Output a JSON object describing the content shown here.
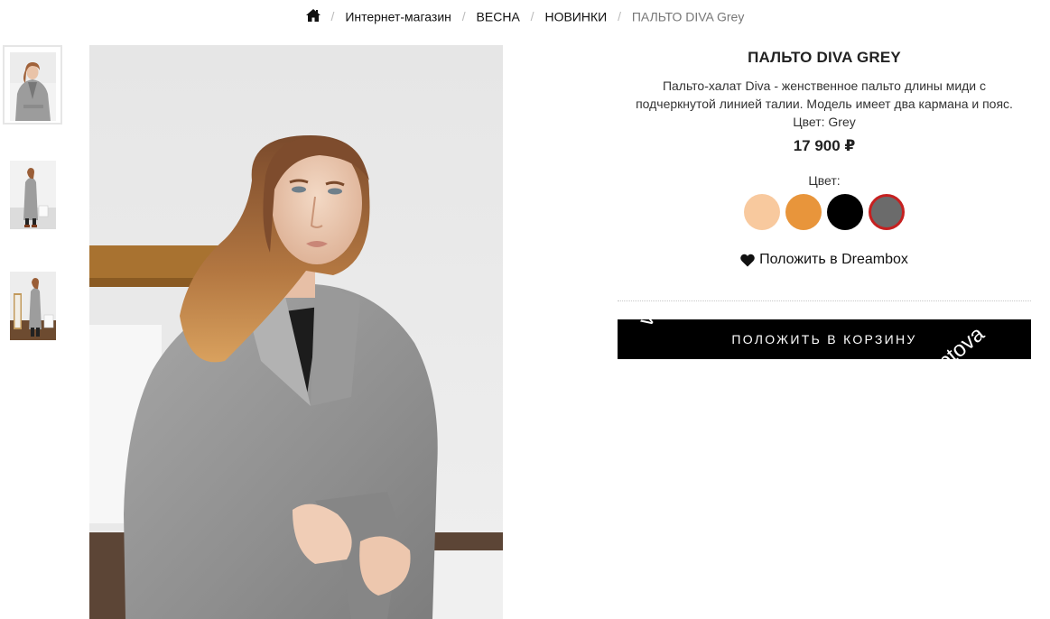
{
  "breadcrumb": {
    "home_icon": "home-icon",
    "items": [
      "Интернет-магазин",
      "ВЕСНА",
      "НОВИНКИ"
    ],
    "current": "ПАЛЬТО DIVA Grey",
    "separator": "/"
  },
  "product": {
    "title": "ПАЛЬТО DIVA GREY",
    "description_line1": "Пальто-халат Diva - женственное пальто длины миди с",
    "description_line2": "подчеркнутой линией талии. Модель имеет два кармана и пояс.",
    "description_line3": "Цвет: Grey",
    "price": "17 900 ₽"
  },
  "colors": {
    "label": "Цвет:",
    "swatches": [
      {
        "name": "peach",
        "hex": "#f8c99e",
        "selected": false
      },
      {
        "name": "orange",
        "hex": "#e8953b",
        "selected": false
      },
      {
        "name": "black",
        "hex": "#000000",
        "selected": false
      },
      {
        "name": "grey",
        "hex": "#6b6b6b",
        "selected": true
      }
    ],
    "selected_border": "#c62020"
  },
  "dreambox": {
    "icon": "heart-icon",
    "label": "Положить в Dreambox"
  },
  "cart": {
    "label": "ПОЛОЖИТЬ В КОРЗИНУ",
    "watermark_left": "varov.ru",
    "watermark_right": "sptova"
  },
  "gallery": {
    "thumbnail_count": 3,
    "active_index": 0
  }
}
